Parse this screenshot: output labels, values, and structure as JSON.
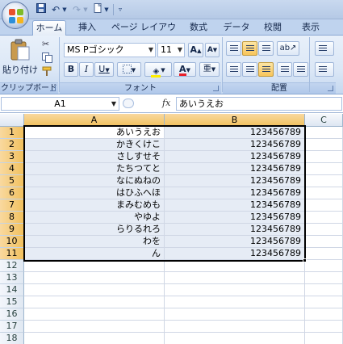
{
  "tabs": [
    "ホーム",
    "挿入",
    "ページ レイアウト",
    "数式",
    "データ",
    "校閲",
    "表示"
  ],
  "clipboard": {
    "paste_label": "貼り付け",
    "group_label": "クリップボード"
  },
  "font": {
    "name": "MS Pゴシック",
    "size": "11",
    "grow_label": "A",
    "shrink_label": "A",
    "bold": "B",
    "italic": "I",
    "underline": "U",
    "color_label": "A",
    "phonetic_label": "亜",
    "group_label": "フォント"
  },
  "alignment": {
    "group_label": "配置"
  },
  "formula_bar": {
    "name_box": "A1",
    "fx": "fx",
    "value": "あいうえお"
  },
  "sheet": {
    "columns": [
      "A",
      "B",
      "C"
    ],
    "rows": [
      {
        "num": "1",
        "a": "あいうえお",
        "b": "123456789"
      },
      {
        "num": "2",
        "a": "かきくけこ",
        "b": "123456789"
      },
      {
        "num": "3",
        "a": "さしすせそ",
        "b": "123456789"
      },
      {
        "num": "4",
        "a": "たちつてと",
        "b": "123456789"
      },
      {
        "num": "5",
        "a": "なにぬねの",
        "b": "123456789"
      },
      {
        "num": "6",
        "a": "はひふへほ",
        "b": "123456789"
      },
      {
        "num": "7",
        "a": "まみむめも",
        "b": "123456789"
      },
      {
        "num": "8",
        "a": "やゆよ",
        "b": "123456789"
      },
      {
        "num": "9",
        "a": "らりるれろ",
        "b": "123456789"
      },
      {
        "num": "10",
        "a": "わを",
        "b": "123456789"
      },
      {
        "num": "11",
        "a": "ん",
        "b": "123456789"
      },
      {
        "num": "12",
        "a": "",
        "b": ""
      },
      {
        "num": "13",
        "a": "",
        "b": ""
      },
      {
        "num": "14",
        "a": "",
        "b": ""
      },
      {
        "num": "15",
        "a": "",
        "b": ""
      },
      {
        "num": "16",
        "a": "",
        "b": ""
      },
      {
        "num": "17",
        "a": "",
        "b": ""
      },
      {
        "num": "18",
        "a": "",
        "b": ""
      }
    ],
    "selected_rows": 11
  },
  "colors": {
    "selection_fill": "#e6ecf5",
    "header_selected": "#f1c15f",
    "ribbon": "#dbe7f6"
  }
}
